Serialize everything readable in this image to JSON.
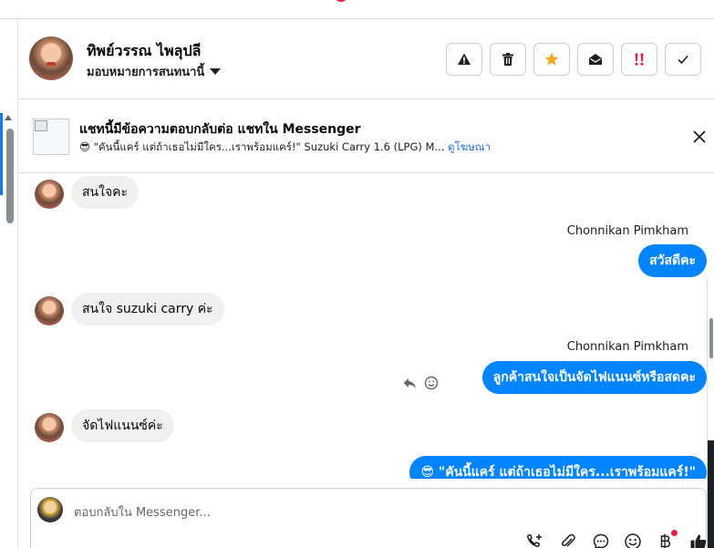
{
  "header": {
    "name": "ทิพย์วรรณ ไพลุปลี",
    "assign_label": "มอบหมายการสนทนานี้",
    "actions": [
      {
        "id": "warning",
        "icon": "warning-icon"
      },
      {
        "id": "delete",
        "icon": "trash-icon"
      },
      {
        "id": "star",
        "icon": "star-icon"
      },
      {
        "id": "mark-unread",
        "icon": "envelope-open-icon"
      },
      {
        "id": "important",
        "icon": "double-exclamation-icon"
      },
      {
        "id": "done",
        "icon": "check-icon"
      }
    ]
  },
  "banner": {
    "title": "แชทนี้มีข้อความตอบกลับต่อ แชทใน Messenger",
    "emoji": "😎",
    "ad_text": "\"คันนี้แคร์ แต่ถ้าเธอไม่มีใคร...เราพร้อมแคร์!\" Suzuki Carry 1.6 (LPG) M...",
    "ad_link": "ดูโฆษณา"
  },
  "messages": [
    {
      "side": "in",
      "text": "สนใจคะ"
    },
    {
      "side": "out",
      "sender": "Chonnikan Pimkham",
      "text": "สวัสดีคะ"
    },
    {
      "side": "in",
      "text": "สนใจ suzuki carry ค่ะ"
    },
    {
      "side": "out",
      "sender": "Chonnikan Pimkham",
      "text": "ลูกค้าสนใจเป็นจัดไฟแนนซ์หรือสดคะ"
    },
    {
      "side": "in",
      "text": "จัดไฟแนนซ์ค่ะ"
    },
    {
      "side": "out",
      "text": "😎 \"คันนี้แคร์ แต่ถ้าเธอไม่มีใคร...เราพร้อมแคร์!\""
    }
  ],
  "composer": {
    "placeholder": "ตอบกลับใน Messenger...",
    "tools": [
      "add-contact-icon",
      "attachment-icon",
      "saved-reply-icon",
      "emoji-icon",
      "baht-icon",
      "thumbs-up-icon"
    ]
  },
  "colors": {
    "outgoing_bubble": "#0084ff",
    "incoming_bubble": "#f0f0f0",
    "star": "#f5a623",
    "important": "#e41e3f",
    "link": "#216fdb"
  }
}
